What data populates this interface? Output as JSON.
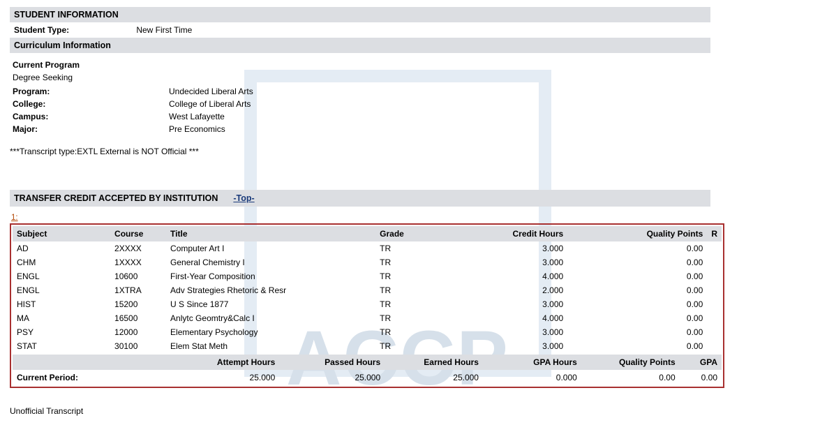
{
  "student_info": {
    "section_title": "STUDENT INFORMATION",
    "type_label": "Student Type:",
    "type_value": "New First Time"
  },
  "curriculum": {
    "section_title": "Curriculum Information",
    "current_program_title": "Current Program",
    "degree_seeking": "Degree Seeking",
    "rows": [
      {
        "label": "Program:",
        "value": "Undecided Liberal Arts"
      },
      {
        "label": "College:",
        "value": "College of Liberal Arts"
      },
      {
        "label": "Campus:",
        "value": "West Lafayette"
      },
      {
        "label": "Major:",
        "value": "Pre Economics"
      }
    ]
  },
  "transcript_note": "***Transcript type:EXTL External is NOT Official ***",
  "transfer": {
    "section_title": "TRANSFER CREDIT ACCEPTED BY INSTITUTION",
    "top_link": "-Top-",
    "sequence_label": "1:",
    "headers": {
      "subject": "Subject",
      "course": "Course",
      "title": "Title",
      "grade": "Grade",
      "credit_hours": "Credit Hours",
      "quality_points": "Quality Points",
      "r": "R"
    },
    "rows": [
      {
        "subject": "AD",
        "course": "2XXXX",
        "title": "Computer Art I",
        "grade": "TR",
        "credit_hours": "3.000",
        "quality_points": "0.00",
        "r": ""
      },
      {
        "subject": "CHM",
        "course": "1XXXX",
        "title": "General Chemistry I",
        "grade": "TR",
        "credit_hours": "3.000",
        "quality_points": "0.00",
        "r": ""
      },
      {
        "subject": "ENGL",
        "course": "10600",
        "title": "First-Year Composition",
        "grade": "TR",
        "credit_hours": "4.000",
        "quality_points": "0.00",
        "r": ""
      },
      {
        "subject": "ENGL",
        "course": "1XTRA",
        "title": "Adv Strategies Rhetoric & Resr",
        "grade": "TR",
        "credit_hours": "2.000",
        "quality_points": "0.00",
        "r": ""
      },
      {
        "subject": "HIST",
        "course": "15200",
        "title": "U S Since 1877",
        "grade": "TR",
        "credit_hours": "3.000",
        "quality_points": "0.00",
        "r": ""
      },
      {
        "subject": "MA",
        "course": "16500",
        "title": "Anlytc Geomtry&Calc I",
        "grade": "TR",
        "credit_hours": "4.000",
        "quality_points": "0.00",
        "r": ""
      },
      {
        "subject": "PSY",
        "course": "12000",
        "title": "Elementary Psychology",
        "grade": "TR",
        "credit_hours": "3.000",
        "quality_points": "0.00",
        "r": ""
      },
      {
        "subject": "STAT",
        "course": "30100",
        "title": "Elem Stat Meth",
        "grade": "TR",
        "credit_hours": "3.000",
        "quality_points": "0.00",
        "r": ""
      }
    ],
    "totals_headers": {
      "blank": "",
      "attempt": "Attempt Hours",
      "passed": "Passed Hours",
      "earned": "Earned Hours",
      "gpa_hours": "GPA Hours",
      "quality_points": "Quality Points",
      "gpa": "GPA"
    },
    "totals_row": {
      "label": "Current Period:",
      "attempt": "25.000",
      "passed": "25.000",
      "earned": "25.000",
      "gpa_hours": "0.000",
      "quality_points": "0.00",
      "gpa": "0.00"
    }
  },
  "footer_note": "Unofficial Transcript",
  "watermark_text": "ACCP"
}
